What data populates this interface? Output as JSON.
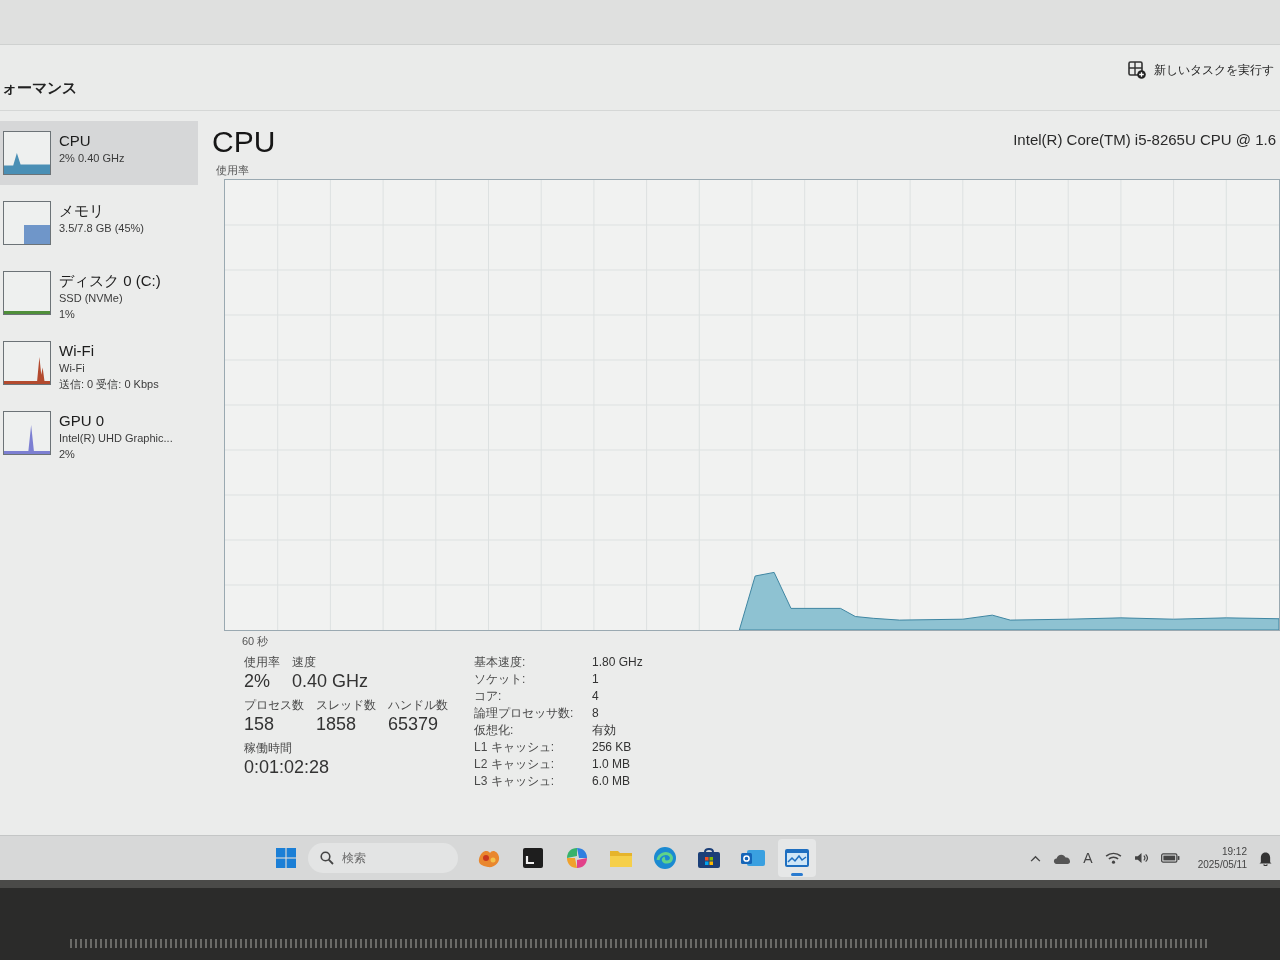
{
  "window": {
    "page_title": "ォーマンス",
    "run_new_task": {
      "label": "新しいタスクを実行す"
    }
  },
  "sidebar": {
    "items": [
      {
        "kind": "cpu",
        "name": "CPU",
        "details": [
          "2% 0.40 GHz"
        ],
        "selected": true,
        "color": "#4a8fb5"
      },
      {
        "kind": "memory",
        "name": "メモリ",
        "details": [
          "3.5/7.8 GB (45%)"
        ],
        "selected": false,
        "color": "#6f96c9"
      },
      {
        "kind": "disk",
        "name": "ディスク 0 (C:)",
        "details": [
          "SSD (NVMe)",
          "1%"
        ],
        "selected": false,
        "color": "#4f8f3a"
      },
      {
        "kind": "network",
        "name": "Wi-Fi",
        "details": [
          "Wi-Fi",
          "送信: 0 受信: 0 Kbps"
        ],
        "selected": false,
        "color": "#b34a2e"
      },
      {
        "kind": "gpu",
        "name": "GPU 0",
        "details": [
          "Intel(R) UHD Graphic...",
          "2%"
        ],
        "selected": false,
        "color": "#7c7fd2"
      }
    ]
  },
  "main": {
    "title": "CPU",
    "processor": "Intel(R) Core(TM) i5-8265U CPU @ 1.6",
    "graph_label": "使用率",
    "graph_time_label": "60 秒",
    "stat_rows": [
      [
        {
          "label": "使用率",
          "value": "2%"
        },
        {
          "label": "速度",
          "value": "0.40 GHz"
        }
      ],
      [
        {
          "label": "プロセス数",
          "value": "158"
        },
        {
          "label": "スレッド数",
          "value": "1858"
        },
        {
          "label": "ハンドル数",
          "value": "65379"
        }
      ],
      [
        {
          "label": "稼働時間",
          "value": "0:01:02:28"
        }
      ]
    ],
    "specs": [
      {
        "label": "基本速度:",
        "value": "1.80 GHz"
      },
      {
        "label": "ソケット:",
        "value": "1"
      },
      {
        "label": "コア:",
        "value": "4"
      },
      {
        "label": "論理プロセッサ数:",
        "value": "8"
      },
      {
        "label": "仮想化:",
        "value": "有効"
      },
      {
        "label": "L1 キャッシュ:",
        "value": "256 KB"
      },
      {
        "label": "L2 キャッシュ:",
        "value": "1.0 MB"
      },
      {
        "label": "L3 キャッシュ:",
        "value": "6.0 MB"
      }
    ]
  },
  "taskbar": {
    "search": {
      "placeholder": "検索"
    },
    "apps": [
      {
        "kind": "widgets",
        "selected": false
      },
      {
        "kind": "terminal",
        "selected": false
      },
      {
        "kind": "swirl",
        "selected": false
      },
      {
        "kind": "folder",
        "selected": false
      },
      {
        "kind": "browser",
        "selected": false
      },
      {
        "kind": "store",
        "selected": false
      },
      {
        "kind": "mail",
        "selected": false
      },
      {
        "kind": "monitor",
        "selected": true
      }
    ],
    "tray": {
      "ime": "A",
      "time": "19:12",
      "date": "2025/05/11"
    }
  }
}
